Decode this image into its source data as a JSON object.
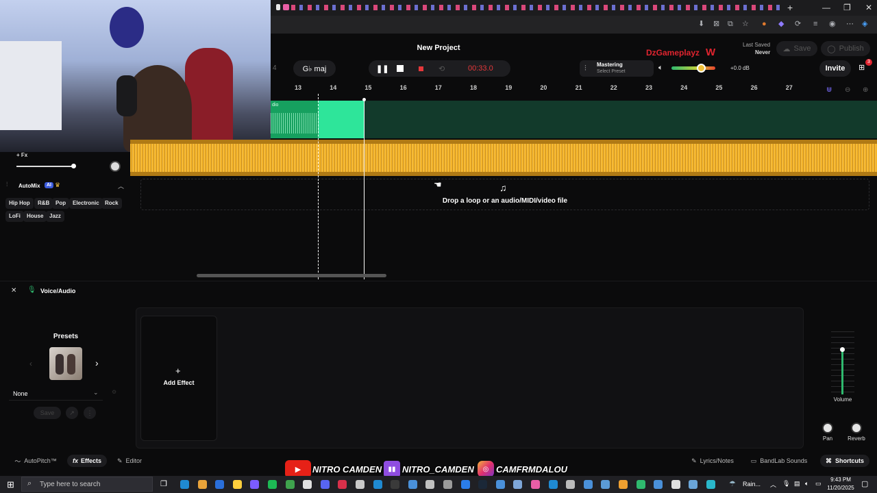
{
  "app": {
    "title": "New Project",
    "brand_text": "DzGameplayz",
    "brand_mark": "W",
    "brand_color": "#e0242f",
    "last_saved_label": "Last Saved",
    "last_saved_value": "Never",
    "save_label": "Save",
    "publish_label": "Publish",
    "invite_label": "Invite",
    "notification_count": "3"
  },
  "transport": {
    "beats_fragment": "4",
    "key": "G♭ maj",
    "time": "00:33.0",
    "time_color": "#e5383b"
  },
  "mastering": {
    "label": "Mastering",
    "preset": "Select Preset",
    "gain": "+0.0 dB"
  },
  "ruler": [
    "13",
    "14",
    "15",
    "16",
    "17",
    "18",
    "19",
    "20",
    "21",
    "22",
    "23",
    "24",
    "25",
    "26",
    "27"
  ],
  "tracks": {
    "clip_label": "dio",
    "track_fx": "+ Fx",
    "drop_text": "Drop a loop or an audio/MIDI/video file"
  },
  "automix": {
    "label": "AutoMix",
    "ai_badge": "AI",
    "genres": [
      "Hip Hop",
      "R&B",
      "Pop",
      "Electronic",
      "Rock",
      "LoFi",
      "House",
      "Jazz"
    ]
  },
  "panel": {
    "title": "Voice/Audio",
    "presets_label": "Presets",
    "preset_value": "None",
    "save_label": "Save",
    "add_effect_label": "Add Effect",
    "volume_label": "Volume",
    "pan_label": "Pan",
    "reverb_label": "Reverb"
  },
  "bottom_tabs": {
    "autopitch": "AutoPitch™",
    "effects": "Effects",
    "editor": "Editor",
    "lyrics": "Lyrics/Notes",
    "sounds": "BandLab Sounds",
    "shortcuts": "Shortcuts"
  },
  "overlay": {
    "youtube": "NITRO CAMDEN",
    "twitch": "NITRO_CAMDEN",
    "instagram": "CAMFRMDALOU"
  },
  "taskbar": {
    "search_placeholder": "Type here to search",
    "weather": "Rain...",
    "time": "9:43 PM",
    "date": "11/20/2025"
  }
}
